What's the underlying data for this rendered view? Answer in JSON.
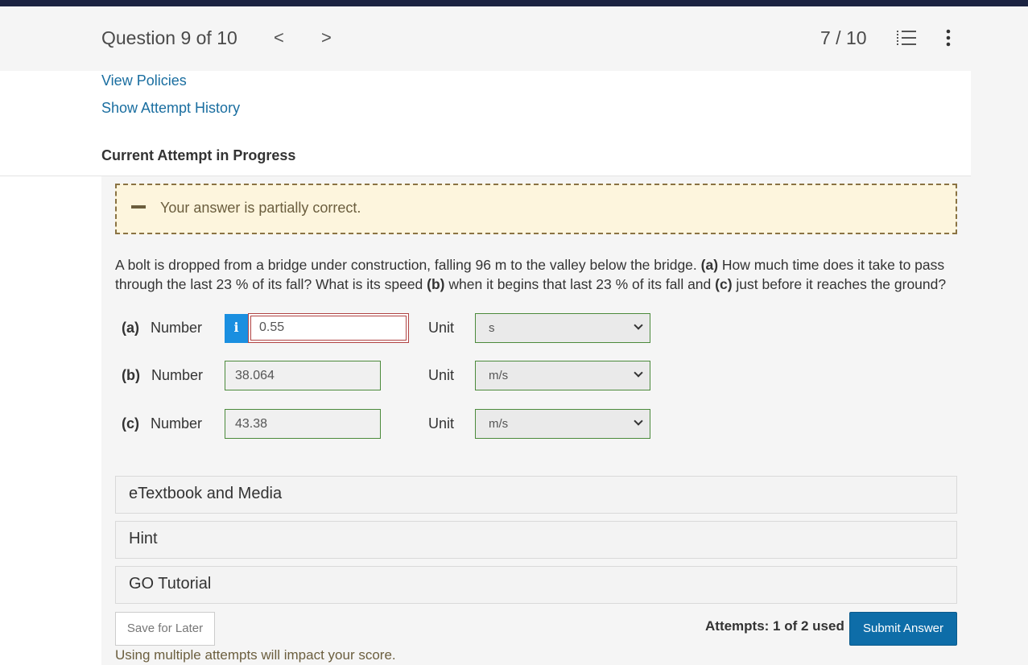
{
  "header": {
    "question_title": "Question 9 of 10",
    "prev_glyph": "<",
    "next_glyph": ">",
    "score": "7 / 10"
  },
  "links": {
    "view_policies": "View Policies",
    "attempt_history": "Show Attempt History"
  },
  "attempt_heading": "Current Attempt in Progress",
  "feedback": {
    "text": "Your answer is partially correct."
  },
  "problem": {
    "text_1": "A bolt is dropped from a bridge under construction, falling 96 m to the valley below the bridge. ",
    "a_label": "(a)",
    "text_2": " How much time does it take to pass through the last 23 % of its fall? What is its speed ",
    "b_label": "(b)",
    "text_3": " when it begins that last 23 % of its fall and ",
    "c_label": "(c)",
    "text_4": " just before it reaches the ground?"
  },
  "parts": [
    {
      "label": "(a)",
      "number_label": "Number",
      "value": "0.55",
      "unit_label": "Unit",
      "unit": "s"
    },
    {
      "label": "(b)",
      "number_label": "Number",
      "value": "38.064",
      "unit_label": "Unit",
      "unit": "m/s"
    },
    {
      "label": "(c)",
      "number_label": "Number",
      "value": "43.38",
      "unit_label": "Unit",
      "unit": "m/s"
    }
  ],
  "info_glyph": "i",
  "accordions": [
    "eTextbook and Media",
    "Hint",
    "GO Tutorial"
  ],
  "footer": {
    "save_label": "Save for Later",
    "attempts": "Attempts: 1 of 2 used",
    "submit_label": "Submit Answer",
    "warning": "Using multiple attempts will impact your score."
  },
  "colors": {
    "accent": "#0e6da8",
    "link": "#1a6ea0",
    "topbar": "#1b2341",
    "correct_border": "#4b8a3b",
    "incorrect_border": "#b04343",
    "feedback_bg": "#fdf5dd"
  },
  "icons": [
    "chevron-left-icon",
    "chevron-right-icon",
    "question-list-icon",
    "more-vertical-icon",
    "partial-minus-icon",
    "info-icon",
    "chevron-down-icon"
  ]
}
